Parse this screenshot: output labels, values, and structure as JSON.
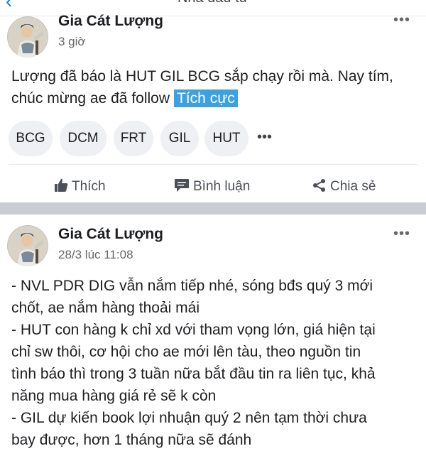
{
  "header": {
    "title": "Nhà đầu tư",
    "back_icon": "chevron-left-icon"
  },
  "posts": [
    {
      "author": "Gia Cát Lượng",
      "time": "3 giờ",
      "content_lines": [
        "Lượng đã báo là HUT GIL BCG sắp chạy rồi mà. Nay tím,",
        "chúc mừng ae đã follow"
      ],
      "sentiment_label": "Tích cực",
      "sentiment_color": "#3da1e0",
      "tags": [
        "BCG",
        "DCM",
        "FRT",
        "GIL",
        "HUT"
      ],
      "tags_more": "•••",
      "actions": {
        "like": "Thích",
        "comment": "Bình luận",
        "share": "Chia sẻ"
      }
    },
    {
      "author": "Gia Cát Lượng",
      "time": "28/3 lúc 11:08",
      "content_lines": [
        "- NVL PDR DIG vẫn nắm tiếp nhé, sóng bđs quý 3 mới",
        "chốt, ae nắm hàng thoải mái",
        "- HUT con hàng k chỉ xd với tham vọng lớn, giá hiện tại",
        "chỉ sw thôi, cơ hội cho ae mới lên tàu, theo nguồn tin",
        "tình báo thì trong 3 tuần nữa bắt đầu tin ra liên tục, khả",
        "năng mua hàng giá rẻ sẽ k còn",
        "- GIL dự kiến book lợi nhuận quý 2 nên tạm thời chưa",
        "bay được, hơn 1 tháng nữa sẽ đánh"
      ]
    }
  ],
  "more_icon": "•••"
}
